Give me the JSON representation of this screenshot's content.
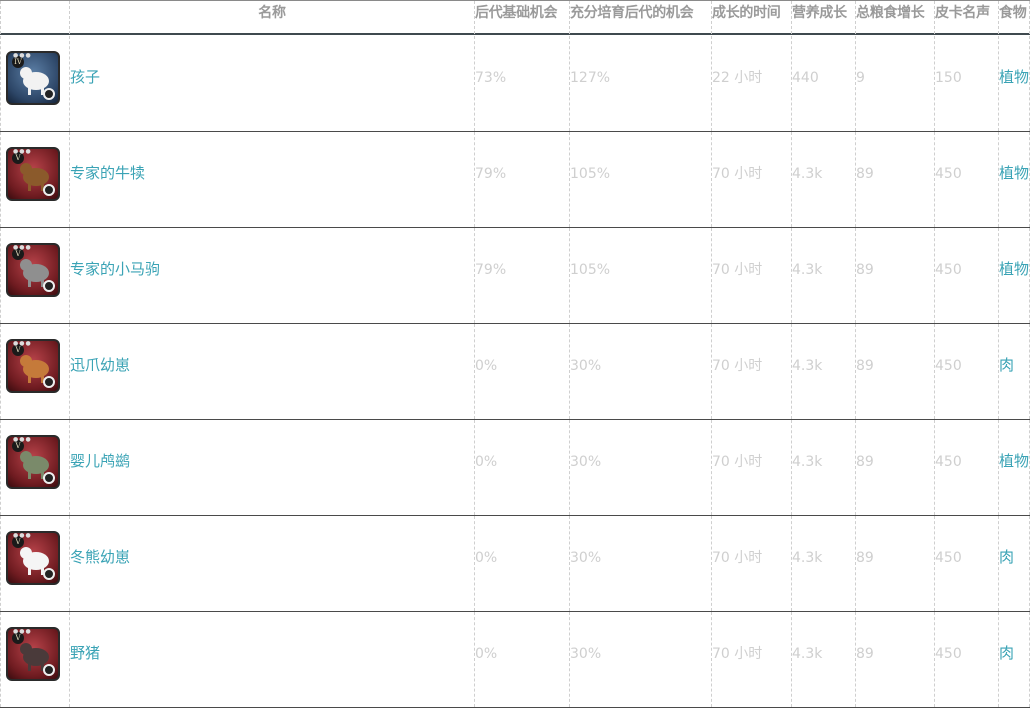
{
  "headers": {
    "name": "名称",
    "base_chance": "后代基础机会",
    "full_chance": "充分培育后代的机会",
    "grow_time": "成长的时间",
    "nutrition": "营养成长",
    "total_food": "总粮食增长",
    "fame": "皮卡名声",
    "food": "食物"
  },
  "rows": [
    {
      "name": "孩子",
      "base": "73%",
      "full": "127%",
      "time": "22  小时",
      "nutrition": "440",
      "total": "9",
      "fame": "150",
      "food": "植物",
      "tier": "IV",
      "icon": "wolf-cub-icon",
      "frame": "blue",
      "color": "#f2f2f2"
    },
    {
      "name": "专家的牛犊",
      "base": "79%",
      "full": "105%",
      "time": "70  小时",
      "nutrition": "4.3k",
      "total": "89",
      "fame": "450",
      "food": "植物",
      "tier": "V",
      "icon": "calf-icon",
      "frame": "red",
      "color": "#8b5a2b"
    },
    {
      "name": "专家的小马驹",
      "base": "79%",
      "full": "105%",
      "time": "70  小时",
      "nutrition": "4.3k",
      "total": "89",
      "fame": "450",
      "food": "植物",
      "tier": "V",
      "icon": "foal-icon",
      "frame": "red",
      "color": "#8f8f8f"
    },
    {
      "name": "迅爪幼崽",
      "base": "0%",
      "full": "30%",
      "time": "70  小时",
      "nutrition": "4.3k",
      "total": "89",
      "fame": "450",
      "food": "肉",
      "tier": "V",
      "icon": "swiftclaw-cub-icon",
      "frame": "red",
      "color": "#c57a3a"
    },
    {
      "name": "婴儿鸬鹚",
      "base": "0%",
      "full": "30%",
      "time": "70  小时",
      "nutrition": "4.3k",
      "total": "89",
      "fame": "450",
      "food": "植物",
      "tier": "V",
      "icon": "moa-chick-icon",
      "frame": "red",
      "color": "#7a8a6a"
    },
    {
      "name": "冬熊幼崽",
      "base": "0%",
      "full": "30%",
      "time": "70  小时",
      "nutrition": "4.3k",
      "total": "89",
      "fame": "450",
      "food": "肉",
      "tier": "V",
      "icon": "winter-bear-cub-icon",
      "frame": "red",
      "color": "#f5f5f5"
    },
    {
      "name": "野猪",
      "base": "0%",
      "full": "30%",
      "time": "70  小时",
      "nutrition": "4.3k",
      "total": "89",
      "fame": "450",
      "food": "肉",
      "tier": "V",
      "icon": "boar-icon",
      "frame": "red",
      "color": "#4a3a3a"
    }
  ]
}
